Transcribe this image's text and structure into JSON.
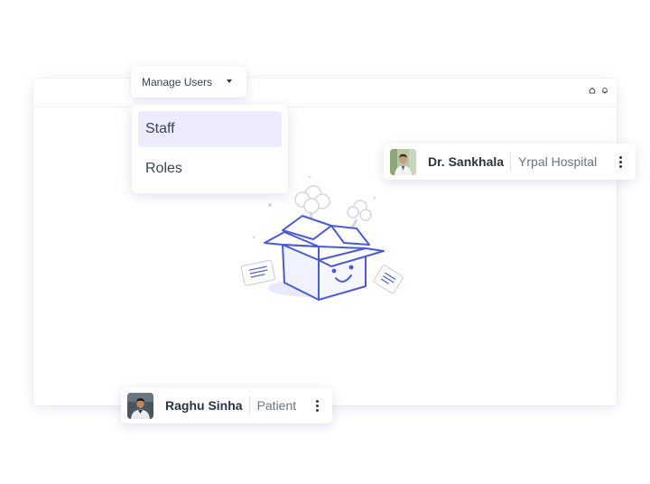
{
  "menu": {
    "trigger_label": "Manage Users",
    "items": [
      {
        "label": "Staff",
        "active": true
      },
      {
        "label": "Roles",
        "active": false
      }
    ]
  },
  "header": {
    "icons": [
      "home-icon",
      "bell-icon"
    ]
  },
  "users": [
    {
      "name": "Dr. Sankhala",
      "role": "Yrpal Hospital",
      "avatar": "doctor-avatar"
    },
    {
      "name": "Raghu Sinha",
      "role": "Patient",
      "avatar": "patient-avatar"
    }
  ],
  "colors": {
    "accent": "#4a5bd4",
    "accent_light": "#ececfd",
    "text_dark": "#2a3340",
    "text_muted": "#6b7380"
  }
}
